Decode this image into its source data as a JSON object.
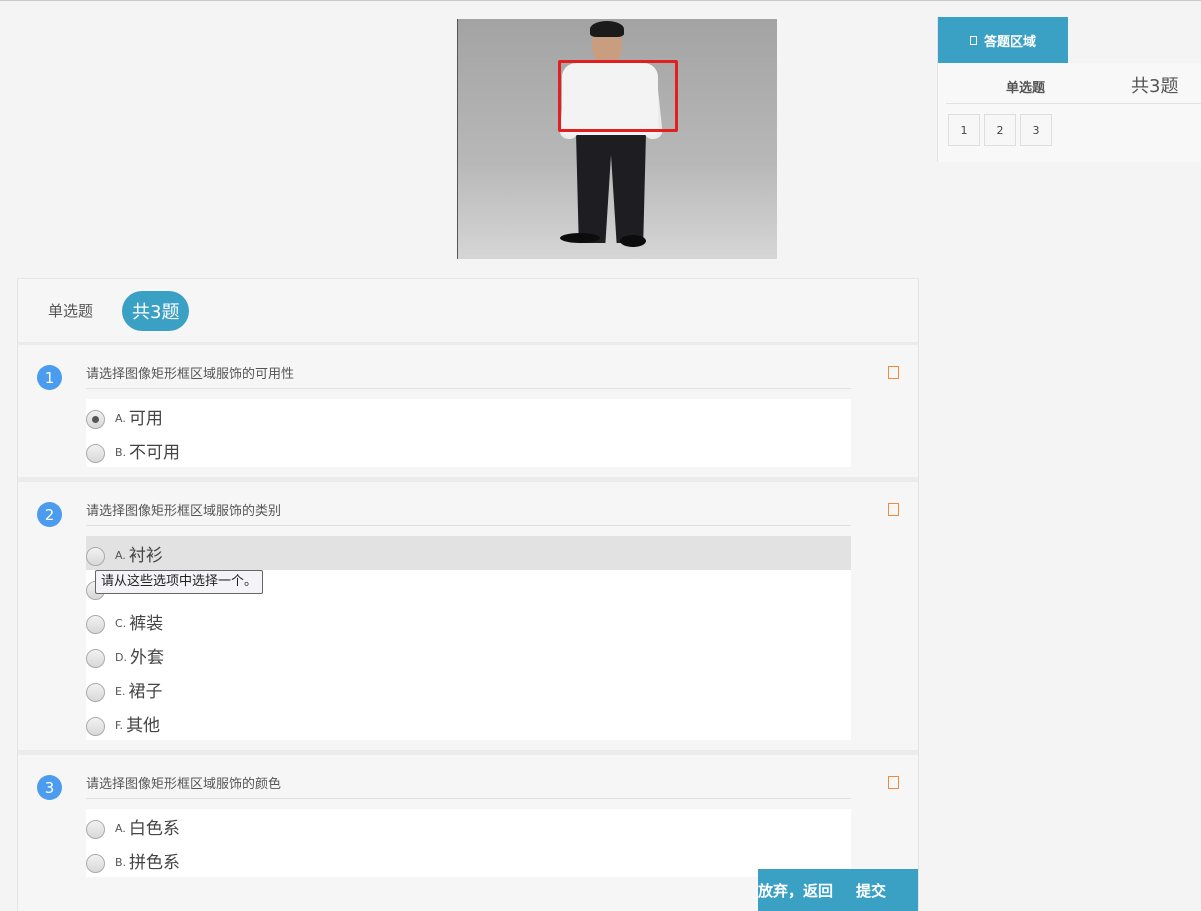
{
  "sidebar": {
    "tab_label": "答题区域",
    "section_type": "单选题",
    "section_count": "共3题",
    "question_numbers": [
      "1",
      "2",
      "3"
    ]
  },
  "header": {
    "type": "单选题",
    "count": "共3题"
  },
  "questions": [
    {
      "number": "1",
      "title": "请选择图像矩形框区域服饰的可用性",
      "options": [
        {
          "key": "A.",
          "text": "可用",
          "checked": true
        },
        {
          "key": "B.",
          "text": "不可用",
          "checked": false
        }
      ]
    },
    {
      "number": "2",
      "title": "请选择图像矩形框区域服饰的类别",
      "tooltip": "请从这些选项中选择一个。",
      "options": [
        {
          "key": "A.",
          "text": "衬衫",
          "checked": false
        },
        {
          "key": "B.",
          "text": "",
          "checked": false
        },
        {
          "key": "C.",
          "text": "裤装",
          "checked": false
        },
        {
          "key": "D.",
          "text": "外套",
          "checked": false
        },
        {
          "key": "E.",
          "text": "裙子",
          "checked": false
        },
        {
          "key": "F.",
          "text": "其他",
          "checked": false
        }
      ]
    },
    {
      "number": "3",
      "title": "请选择图像矩形框区域服饰的颜色",
      "options": [
        {
          "key": "A.",
          "text": "白色系",
          "checked": false
        },
        {
          "key": "B.",
          "text": "拼色系",
          "checked": false
        }
      ]
    }
  ],
  "actions": {
    "quit_label": "放弃，返回",
    "submit_label": "提交"
  },
  "colors": {
    "accent": "#3aa0c4",
    "question_number": "#4b9bef",
    "mark_border": "#f08a3c",
    "bbox": "#e02020"
  }
}
